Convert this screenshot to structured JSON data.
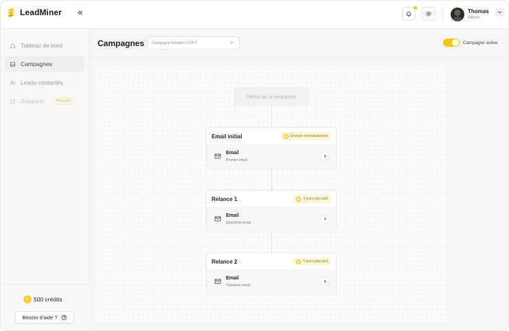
{
  "brand": {
    "name": "LeadMiner",
    "accent": "#f5c518"
  },
  "header": {
    "collapse_icon": "chevrons-left-icon",
    "user": {
      "name": "Thomas",
      "role": "Admin"
    }
  },
  "sidebar": {
    "items": [
      {
        "label": "Tableau de bord",
        "icon": "home-icon"
      },
      {
        "label": "Campagnes",
        "icon": "inbox-icon",
        "active": true
      },
      {
        "label": "Leads contactés",
        "icon": "user-check-icon"
      },
      {
        "label": "Rapports",
        "icon": "chart-icon",
        "badge": "Premium"
      }
    ],
    "credits": "500 crédits",
    "help_label": "Besoin d'aide ?"
  },
  "main": {
    "title": "Campagnes",
    "campaign_select": "Campagne Produit 1 ICP 2",
    "toggle_label": "Campagne active",
    "toggle_on": true,
    "start_node": "Début de la séquence",
    "steps": [
      {
        "title": "Email initial",
        "badge": "Envoyer immédiatement",
        "type": "Email",
        "subtitle": "Premier email"
      },
      {
        "title": "Relance 1",
        "badge": "3 jours plus tard",
        "type": "Email",
        "subtitle": "Deuxième email"
      },
      {
        "title": "Relance 2",
        "badge": "5 jours plus tard",
        "type": "Email",
        "subtitle": "Troisième email"
      }
    ]
  }
}
